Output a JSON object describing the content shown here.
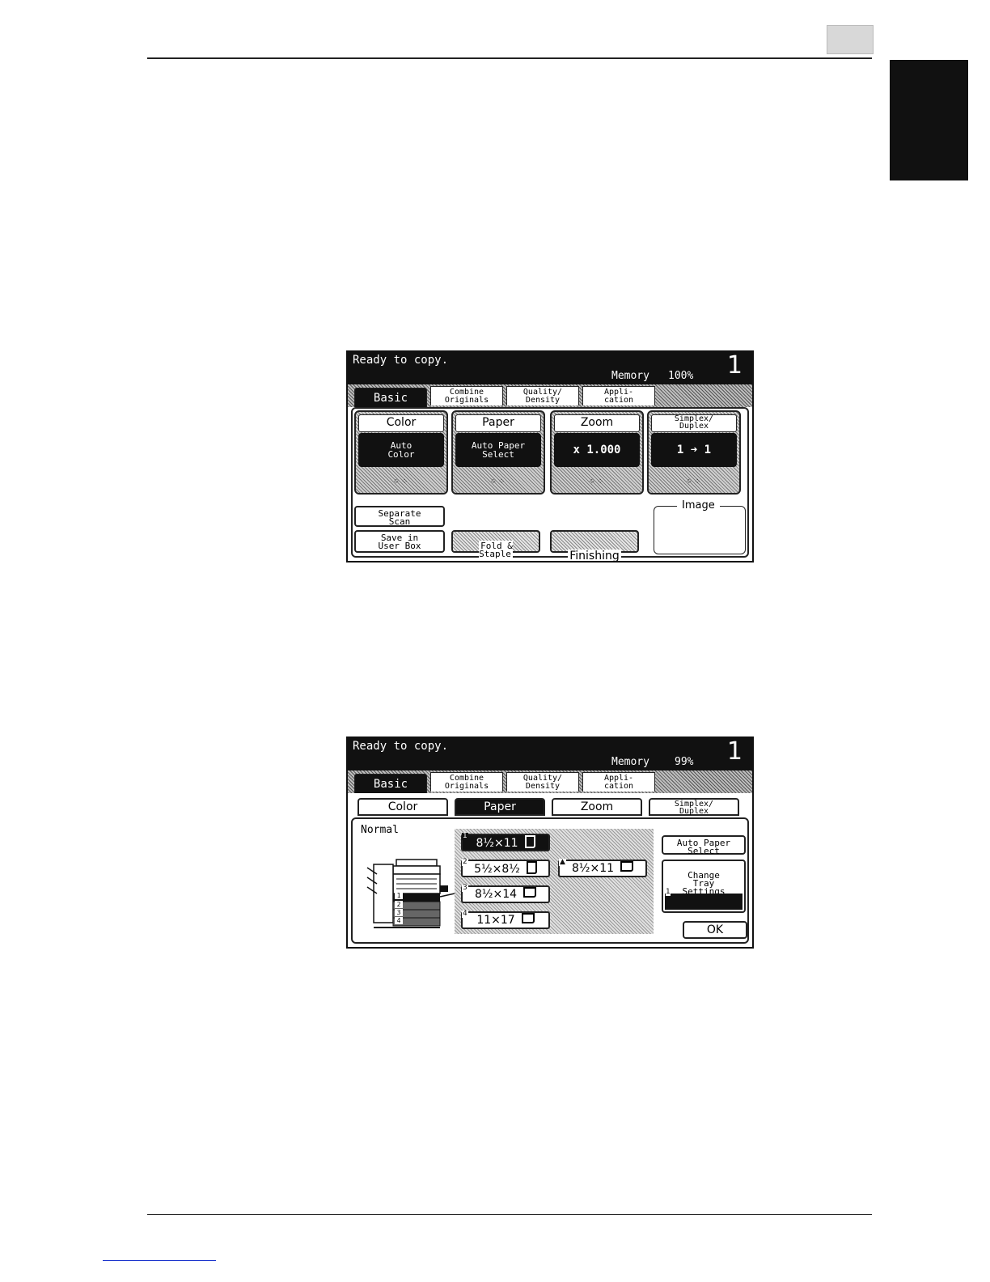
{
  "page": {
    "side_tab_color": "#111111"
  },
  "screen1": {
    "status": "Ready to copy.",
    "memory_label": "Memory",
    "memory_value": "100%",
    "copy_count": "1",
    "tabs": [
      "Basic",
      "Combine\nOriginals",
      "Quality/\nDensity",
      "Appli-\ncation"
    ],
    "functions": [
      {
        "label": "Color",
        "value": "Auto\nColor"
      },
      {
        "label": "Paper",
        "value": "Auto Paper\nSelect"
      },
      {
        "label": "Zoom",
        "value": "x 1.000"
      },
      {
        "label": "Simplex/\nDuplex",
        "value": "1 ➜ 1"
      }
    ],
    "buttons": {
      "separate_scan": "Separate\nScan",
      "save_in_user_box": "Save in\nUser Box",
      "fold_staple": "Fold &\nStaple",
      "finishing": "Finishing"
    },
    "image_title": "Image"
  },
  "screen2": {
    "status": "Ready to copy.",
    "memory_label": "Memory",
    "memory_value": "99%",
    "copy_count": "1",
    "tabs": [
      "Basic",
      "Combine\nOriginals",
      "Quality/\nDensity",
      "Appli-\ncation"
    ],
    "subtabs": [
      "Color",
      "Paper",
      "Zoom",
      "Simplex/\nDuplex"
    ],
    "normal_label": "Normal",
    "trays": [
      {
        "num": "1",
        "size": "8½×11"
      },
      {
        "num": "2",
        "size": "5½×8½"
      },
      {
        "num": "3",
        "size": "8½×14"
      },
      {
        "num": "4",
        "size": "11×17"
      },
      {
        "num": "▲",
        "size": "8½×11"
      }
    ],
    "machine_tray_labels": [
      "1",
      "2",
      "3",
      "4"
    ],
    "auto_paper_select": "Auto Paper\nSelect",
    "change_tray_settings": "Change\nTray\nSettings",
    "current_tray": {
      "num": "1",
      "size": "8½×11"
    },
    "ok": "OK"
  }
}
